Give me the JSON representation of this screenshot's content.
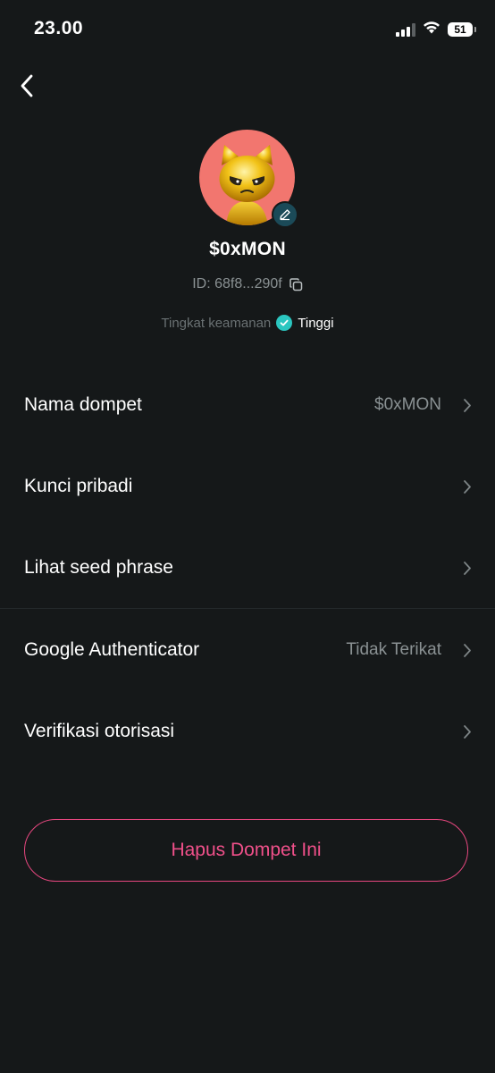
{
  "status_bar": {
    "time": "23.00",
    "battery": "51"
  },
  "profile": {
    "wallet_name": "$0xMON",
    "id_label": "ID: 68f8...290f",
    "security_label": "Tingkat keamanan",
    "security_value": "Tinggi",
    "avatar_bg": "#f2766f"
  },
  "menu": {
    "wallet_name": {
      "label": "Nama dompet",
      "value": "$0xMON"
    },
    "private_key": {
      "label": "Kunci pribadi"
    },
    "seed_phrase": {
      "label": "Lihat seed phrase"
    },
    "google_auth": {
      "label": "Google Authenticator",
      "value": "Tidak Terikat"
    },
    "auth_verification": {
      "label": "Verifikasi otorisasi"
    }
  },
  "actions": {
    "delete_wallet": "Hapus Dompet Ini"
  },
  "colors": {
    "background": "#151819",
    "accent_danger": "#f0508a",
    "security_ok": "#2bc6c0",
    "muted_text": "#8a9193"
  },
  "icons": [
    "back-arrow-icon",
    "edit-pencil-icon",
    "copy-icon",
    "check-icon",
    "chevron-right-icon",
    "wifi-icon",
    "signal-icon",
    "battery-icon"
  ]
}
